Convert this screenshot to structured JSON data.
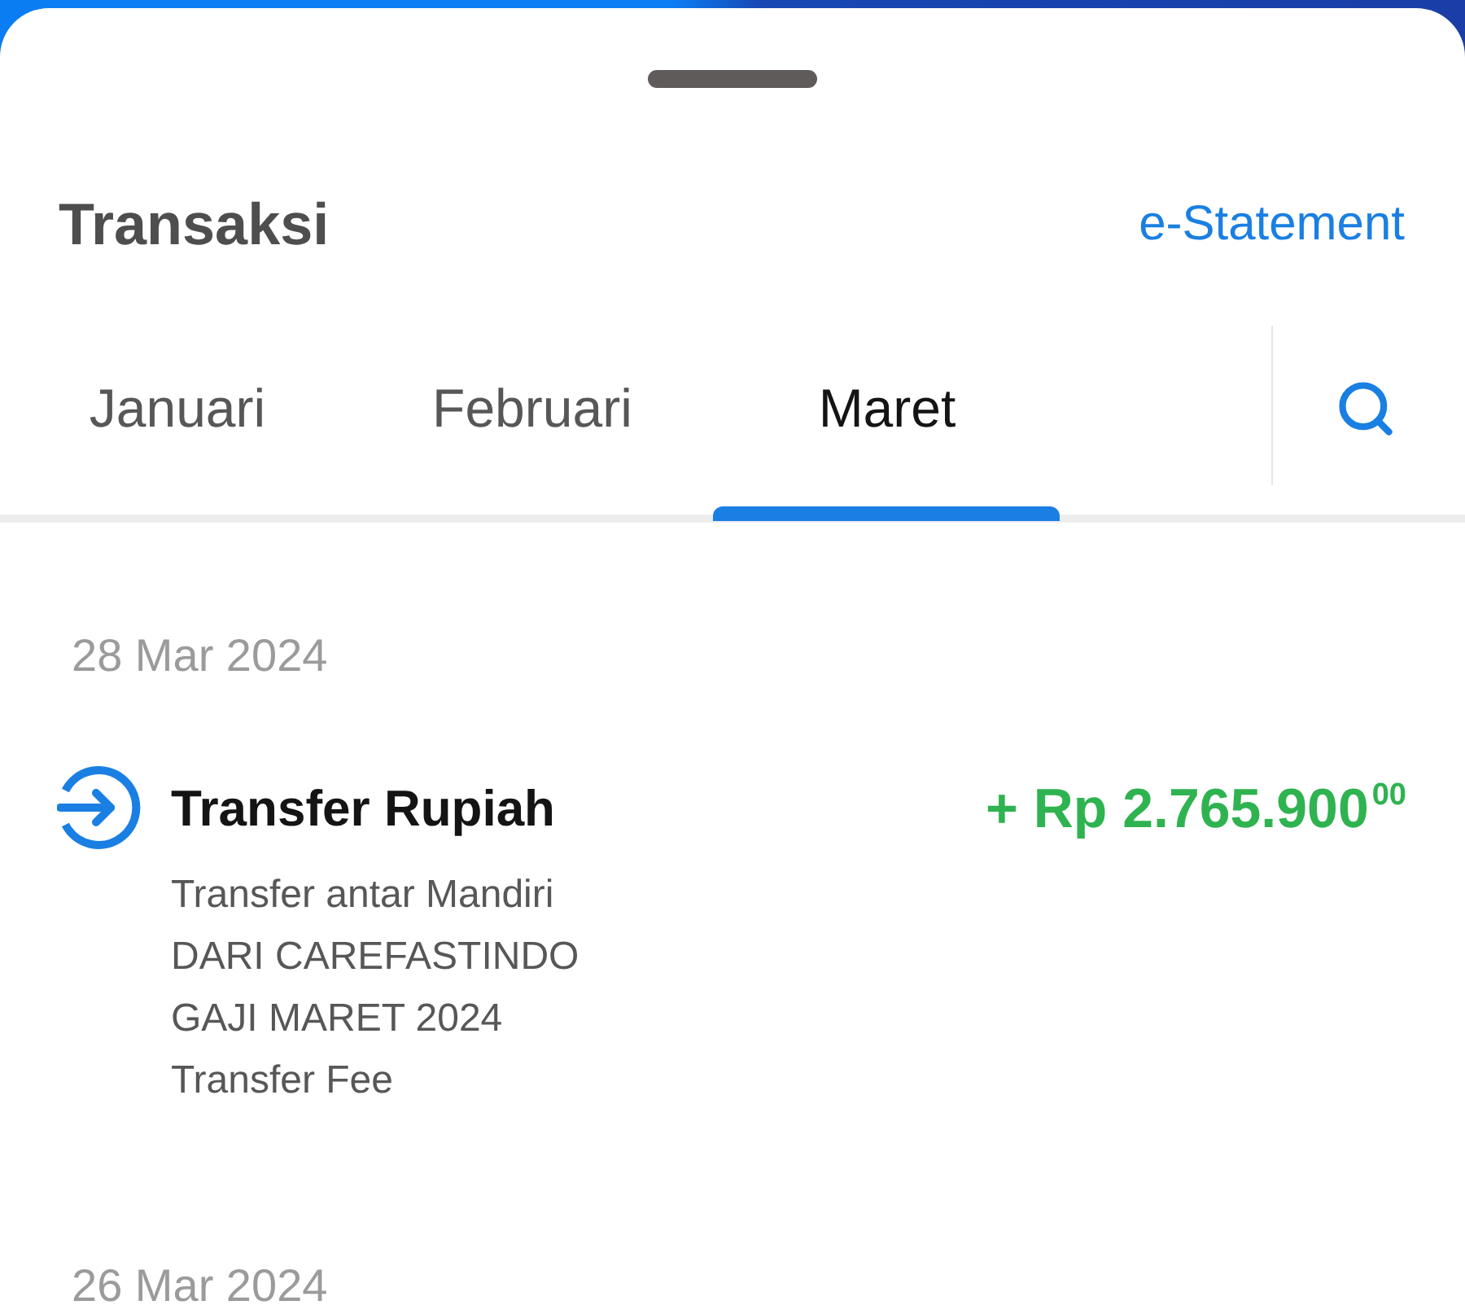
{
  "header": {
    "title": "Transaksi",
    "link": "e-Statement"
  },
  "tabs": [
    {
      "label": "Januari",
      "selected": false
    },
    {
      "label": "Februari",
      "selected": false
    },
    {
      "label": "Maret",
      "selected": true
    }
  ],
  "groups": [
    {
      "date": "28 Mar 2024",
      "transactions": [
        {
          "title": "Transfer Rupiah",
          "amount": "+ Rp 2.765.900$^{00}$",
          "details": [
            "Transfer antar Mandiri",
            "DARI CAREFASTINDO",
            "GAJI MARET 2024",
            "Transfer Fee"
          ]
        }
      ]
    },
    {
      "date": "26 Mar 2024"
    }
  ]
}
